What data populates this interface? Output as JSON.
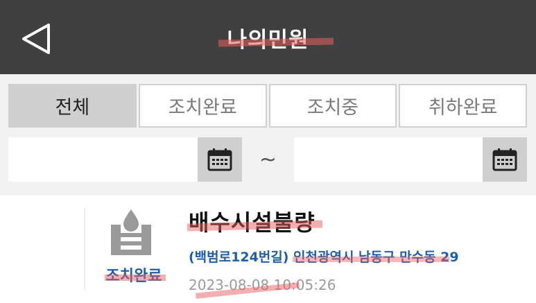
{
  "header": {
    "title": "나의민원",
    "back_icon": "back-triangle-icon",
    "background": "#404040"
  },
  "tabs": [
    {
      "label": "전체",
      "active": true
    },
    {
      "label": "조치완료",
      "active": false
    },
    {
      "label": "조치중",
      "active": false
    },
    {
      "label": "취하완료",
      "active": false
    }
  ],
  "date_filter": {
    "start_value": "",
    "end_value": "",
    "separator": "~",
    "calendar_icon": "calendar-icon"
  },
  "complaints": [
    {
      "status": "조치완료",
      "category_icon": "water-drain-icon",
      "title": "배수시설불량",
      "address": "(백범로124번길) 인천광역시 남동구 만수동 29",
      "datetime": "2023-08-08 10:05:26"
    }
  ],
  "colors": {
    "accent_blue": "#1f5ea8",
    "active_tab": "#cfcfcf",
    "highlight": "#e85f5f"
  }
}
